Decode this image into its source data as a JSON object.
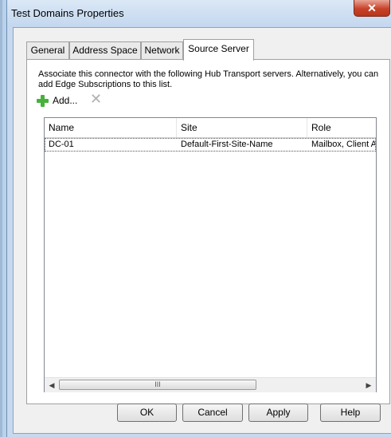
{
  "window": {
    "title": "Test Domains Properties",
    "close_glyph": "✕"
  },
  "tabs": [
    {
      "label": "General"
    },
    {
      "label": "Address Space"
    },
    {
      "label": "Network"
    },
    {
      "label": "Source Server",
      "active": true
    }
  ],
  "panel": {
    "description": "Associate this connector with the following Hub Transport servers. Alternatively, you can add Edge Subscriptions to this list.",
    "add_label": "Add...",
    "add_icon": "plus-icon",
    "remove_icon": "remove-icon"
  },
  "list": {
    "columns": [
      "Name",
      "Site",
      "Role"
    ],
    "rows": [
      {
        "name": "DC-01",
        "site": "Default-First-Site-Name",
        "role": "Mailbox, Client A"
      }
    ],
    "scroll_left": "◀",
    "scroll_right": "▶",
    "thumb_grip": "III"
  },
  "buttons": {
    "ok": "OK",
    "cancel": "Cancel",
    "apply": "Apply",
    "help": "Help"
  },
  "colors": {
    "close": "#c7432a",
    "add_icon": "#46b23c",
    "frame": "#c6d9ef"
  }
}
